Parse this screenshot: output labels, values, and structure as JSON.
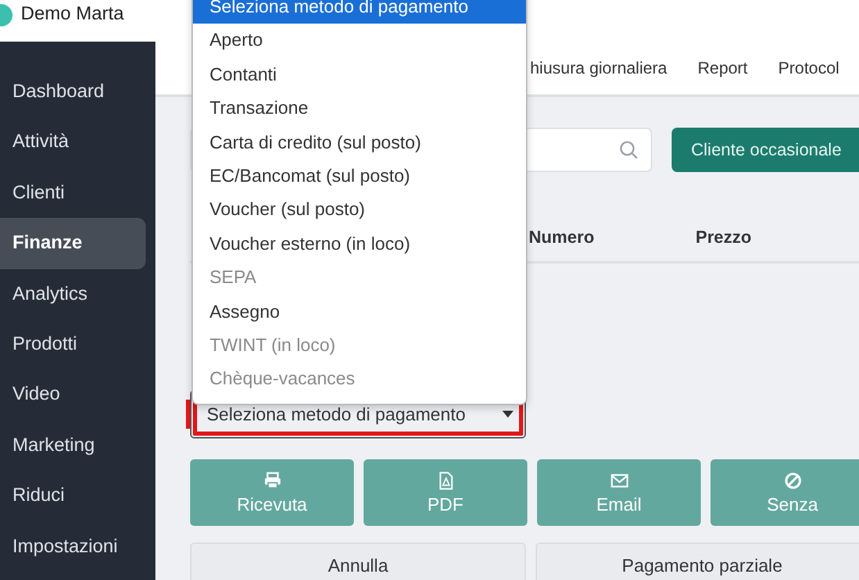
{
  "brand": {
    "name": "Demo Marta"
  },
  "sidebar": {
    "items": [
      {
        "label": "Dashboard",
        "selected": false
      },
      {
        "label": "Attività",
        "selected": false
      },
      {
        "label": "Clienti",
        "selected": false
      },
      {
        "label": "Finanze",
        "selected": true
      },
      {
        "label": "Analytics",
        "selected": false
      },
      {
        "label": "Prodotti",
        "selected": false
      },
      {
        "label": "Video",
        "selected": false
      },
      {
        "label": "Marketing",
        "selected": false
      },
      {
        "label": "Riduci",
        "selected": false
      },
      {
        "label": "Impostazioni",
        "selected": false
      }
    ]
  },
  "tabs": [
    {
      "label": "hiusura giornaliera"
    },
    {
      "label": "Report"
    },
    {
      "label": "Protocol"
    }
  ],
  "guest_button": "Cliente occasionale",
  "table": {
    "columns": [
      "Numero",
      "Prezzo"
    ]
  },
  "payment_select": {
    "value": "Seleziona metodo di pagamento",
    "highlighted": true
  },
  "dropdown": {
    "options": [
      {
        "label": "Seleziona metodo di pagamento",
        "selected": true,
        "disabled": false
      },
      {
        "label": "Aperto",
        "selected": false,
        "disabled": false
      },
      {
        "label": "Contanti",
        "selected": false,
        "disabled": false
      },
      {
        "label": "Transazione",
        "selected": false,
        "disabled": false
      },
      {
        "label": "Carta di credito (sul posto)",
        "selected": false,
        "disabled": false
      },
      {
        "label": "EC/Bancomat (sul posto)",
        "selected": false,
        "disabled": false
      },
      {
        "label": "Voucher (sul posto)",
        "selected": false,
        "disabled": false
      },
      {
        "label": "Voucher esterno (in loco)",
        "selected": false,
        "disabled": false
      },
      {
        "label": "SEPA",
        "selected": false,
        "disabled": true
      },
      {
        "label": "Assegno",
        "selected": false,
        "disabled": false
      },
      {
        "label": "TWINT (in loco)",
        "selected": false,
        "disabled": true
      },
      {
        "label": "Chèque-vacances",
        "selected": false,
        "disabled": true
      }
    ]
  },
  "receipt_buttons": [
    {
      "label": "Ricevuta",
      "kind": "printer"
    },
    {
      "label": "PDF",
      "kind": "pdf"
    },
    {
      "label": "Email",
      "kind": "email"
    },
    {
      "label": "Senza",
      "kind": "none"
    }
  ],
  "footer_buttons": [
    "Annulla",
    "Pagamento parziale"
  ]
}
